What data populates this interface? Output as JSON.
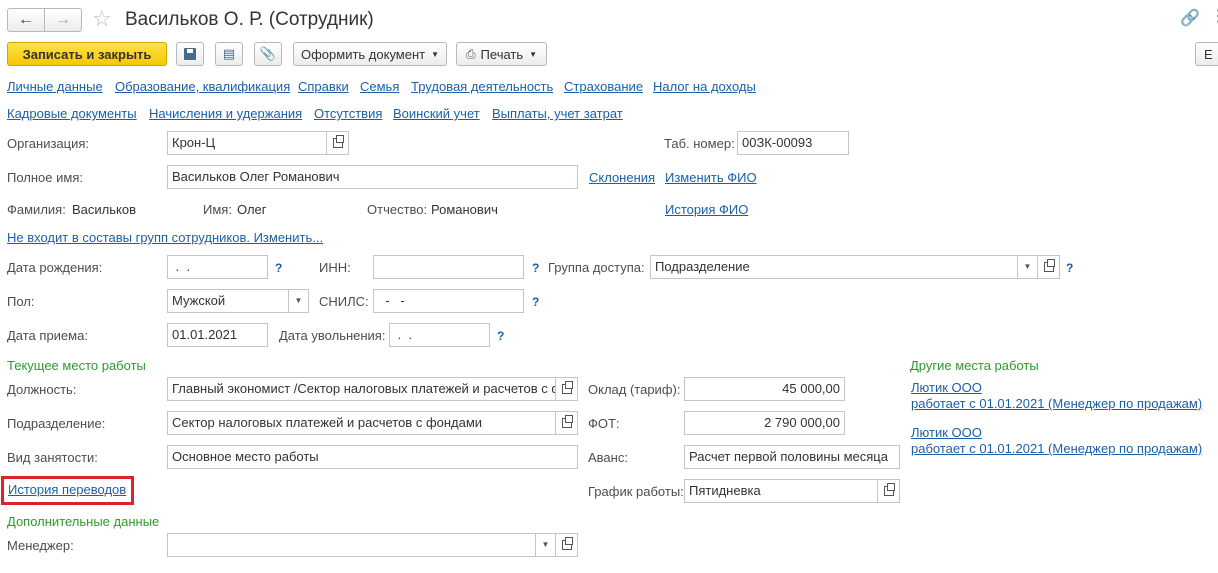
{
  "window": {
    "title": "Васильков О. Р. (Сотрудник)"
  },
  "toolbar": {
    "save_close": "Записать и закрыть",
    "create_doc": "Оформить документ",
    "print": "Печать",
    "more": "Е"
  },
  "nav_links_row1": [
    "Личные данные",
    "Образование, квалификация",
    "Справки",
    "Семья",
    "Трудовая деятельность",
    "Страхование",
    "Налог на доходы"
  ],
  "nav_links_row2": [
    "Кадровые документы",
    "Начисления и удержания",
    "Отсутствия",
    "Воинский учет",
    "Выплаты, учет затрат"
  ],
  "form": {
    "org_label": "Организация:",
    "org_value": "Крон-Ц",
    "tab_label": "Таб. номер:",
    "tab_value": "00ЗК-00093",
    "fullname_label": "Полное имя:",
    "fullname_value": "Васильков Олег Романович",
    "declension_link": "Склонения",
    "change_fio_link": "Изменить ФИО",
    "surname_label": "Фамилия:",
    "surname_value": "Васильков",
    "name_label": "Имя:",
    "name_value": "Олег",
    "patronymic_label": "Отчество:",
    "patronymic_value": "Романович",
    "fio_history_link": "История ФИО",
    "groups_link": "Не входит в составы групп сотрудников. Изменить...",
    "birth_label": "Дата рождения:",
    "birth_value": " .  .",
    "inn_label": "ИНН:",
    "inn_value": "",
    "access_label": "Группа доступа:",
    "access_value": "Подразделение",
    "gender_label": "Пол:",
    "gender_value": "Мужской",
    "snils_label": "СНИЛС:",
    "snils_value": "  -   -",
    "hire_label": "Дата приема:",
    "hire_value": "01.01.2021",
    "fire_label": "Дата увольнения:",
    "fire_value": " .  .",
    "q": "?"
  },
  "current_work": {
    "header": "Текущее место работы",
    "position_label": "Должность:",
    "position_value": "Главный экономист /Сектор налоговых платежей и расчетов с фондами",
    "dept_label": "Подразделение:",
    "dept_value": "Сектор налоговых платежей и расчетов с фондами",
    "emp_type_label": "Вид занятости:",
    "emp_type_value": "Основное место работы",
    "salary_label": "Оклад (тариф):",
    "salary_value": "45 000,00",
    "fot_label": "ФОТ:",
    "fot_value": "2 790 000,00",
    "advance_label": "Аванс:",
    "advance_value": "Расчет первой половины месяца",
    "schedule_label": "График работы:",
    "schedule_value": "Пятидневка",
    "transfer_history_link": "История переводов"
  },
  "other_work": {
    "header": "Другие места работы",
    "items": [
      {
        "org": "Лютик ООО",
        "desc": "работает с 01.01.2021 (Менеджер по продажам)"
      },
      {
        "org": "Лютик ООО",
        "desc": "работает с 01.01.2021 (Менеджер по продажам)"
      }
    ]
  },
  "additional": {
    "header": "Дополнительные данные",
    "manager_label": "Менеджер:",
    "manager_value": ""
  }
}
